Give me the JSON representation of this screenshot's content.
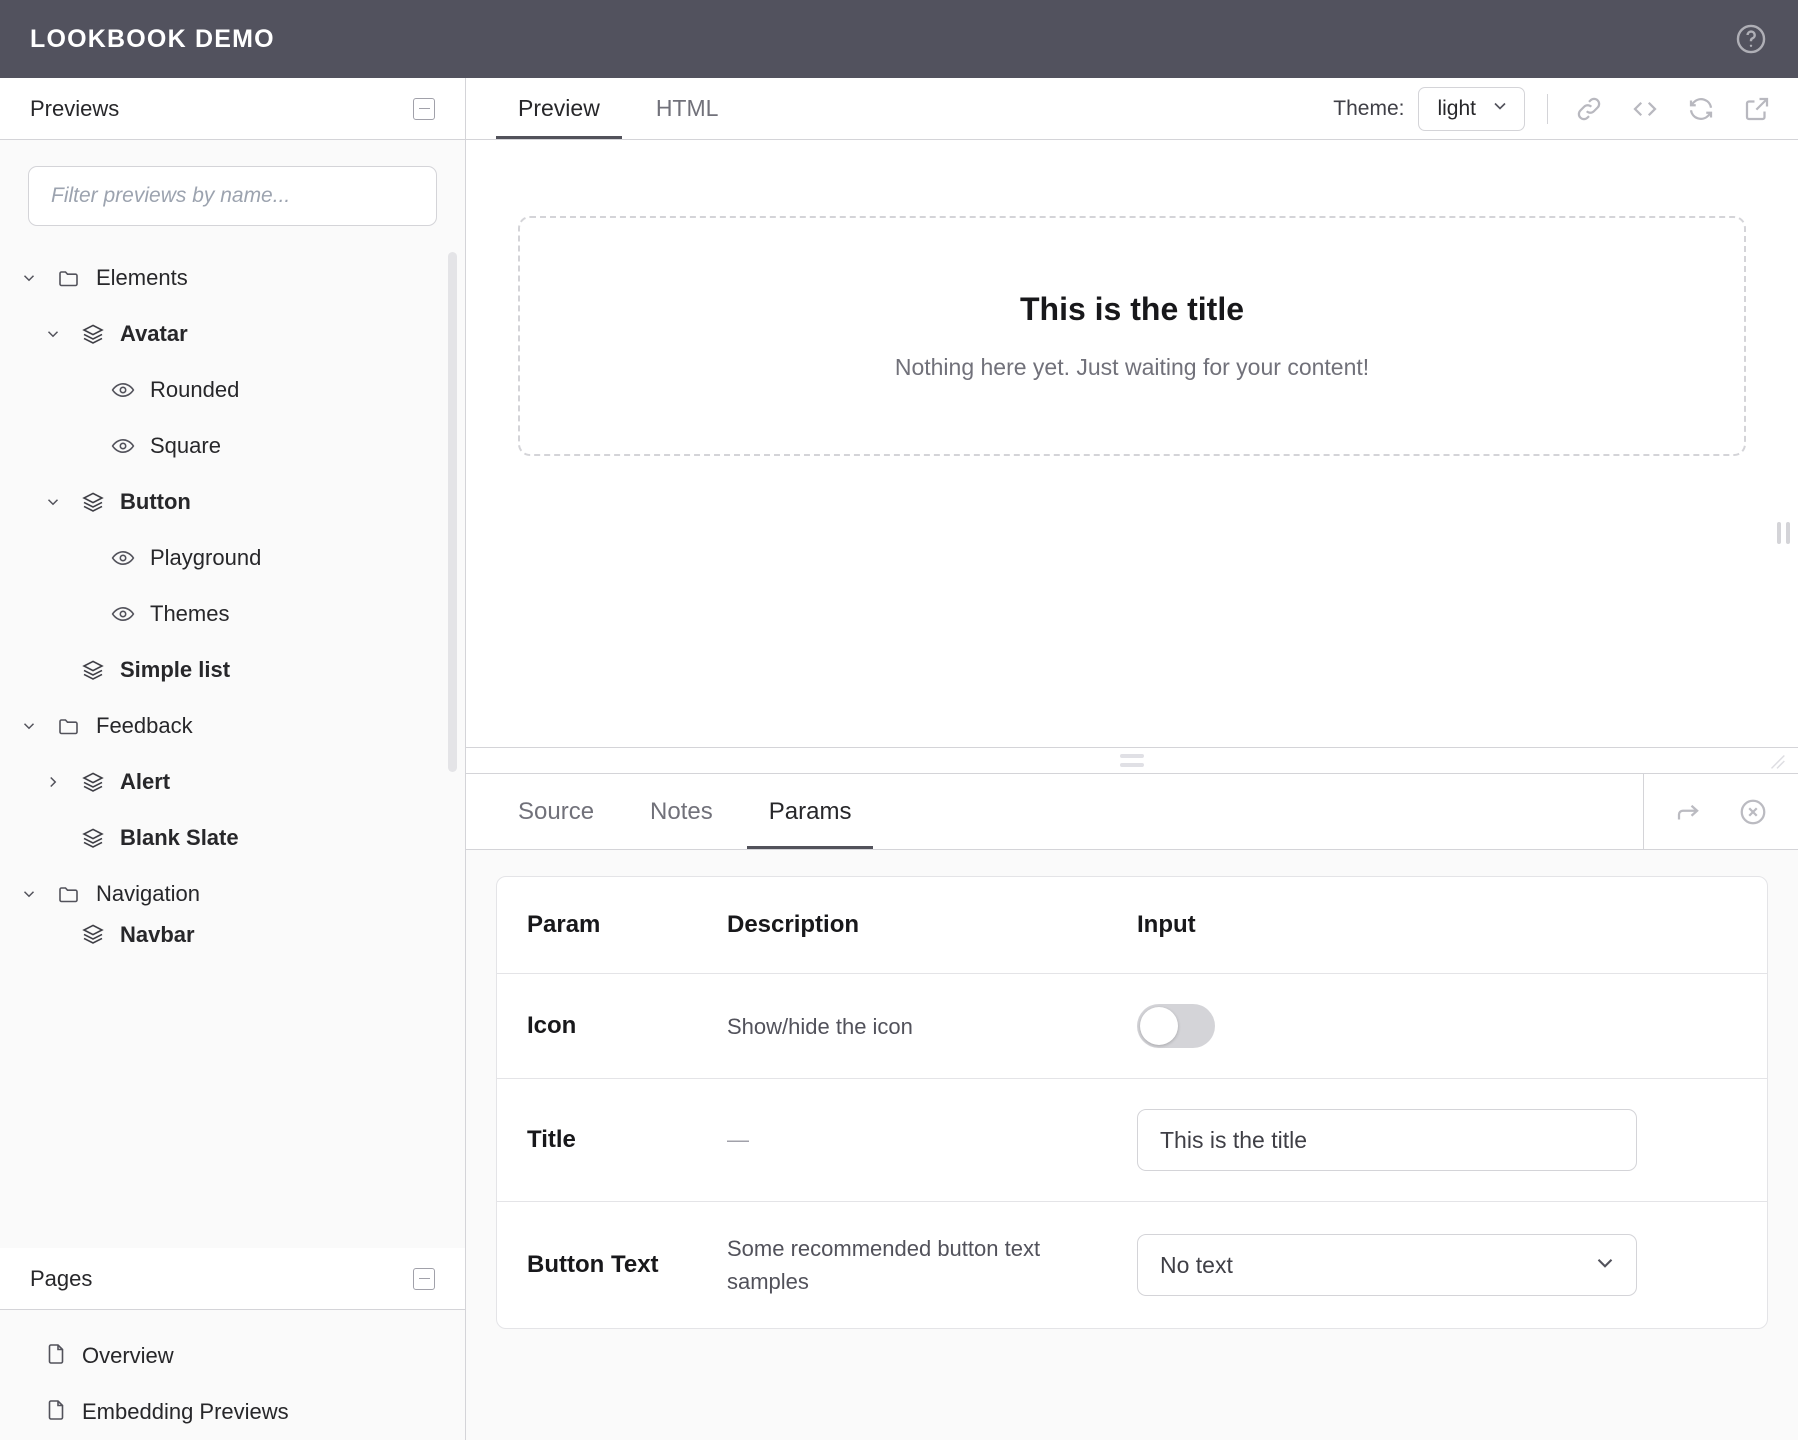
{
  "header": {
    "brand": "LOOKBOOK DEMO",
    "help_icon": "help-circle-icon"
  },
  "sidebar": {
    "previews_panel": {
      "title": "Previews",
      "collapse_icon": "minus-square-icon",
      "filter_placeholder": "Filter previews by name...",
      "tree": [
        {
          "label": "Elements",
          "type": "folder",
          "depth": 0,
          "expanded": true,
          "bold": false,
          "icon": "folder-icon"
        },
        {
          "label": "Avatar",
          "type": "scenario",
          "depth": 1,
          "expanded": true,
          "bold": true,
          "icon": "layers-icon"
        },
        {
          "label": "Rounded",
          "type": "preview",
          "depth": 2,
          "expanded": null,
          "bold": false,
          "icon": "eye-icon"
        },
        {
          "label": "Square",
          "type": "preview",
          "depth": 2,
          "expanded": null,
          "bold": false,
          "icon": "eye-icon"
        },
        {
          "label": "Button",
          "type": "scenario",
          "depth": 1,
          "expanded": true,
          "bold": true,
          "icon": "layers-icon"
        },
        {
          "label": "Playground",
          "type": "preview",
          "depth": 2,
          "expanded": null,
          "bold": false,
          "icon": "eye-icon"
        },
        {
          "label": "Themes",
          "type": "preview",
          "depth": 2,
          "expanded": null,
          "bold": false,
          "icon": "eye-icon"
        },
        {
          "label": "Simple list",
          "type": "scenario",
          "depth": 1,
          "expanded": null,
          "bold": true,
          "icon": "layers-icon"
        },
        {
          "label": "Feedback",
          "type": "folder",
          "depth": 0,
          "expanded": true,
          "bold": false,
          "icon": "folder-icon"
        },
        {
          "label": "Alert",
          "type": "scenario",
          "depth": 1,
          "expanded": false,
          "bold": true,
          "icon": "layers-icon"
        },
        {
          "label": "Blank Slate",
          "type": "scenario",
          "depth": 1,
          "expanded": null,
          "bold": true,
          "icon": "layers-icon"
        },
        {
          "label": "Navigation",
          "type": "folder",
          "depth": 0,
          "expanded": true,
          "bold": false,
          "icon": "folder-icon"
        },
        {
          "label": "Navbar",
          "type": "scenario",
          "depth": 1,
          "expanded": null,
          "bold": true,
          "icon": "layers-icon"
        }
      ]
    },
    "pages_panel": {
      "title": "Pages",
      "collapse_icon": "minus-square-icon",
      "items": [
        {
          "label": "Overview",
          "icon": "file-icon"
        },
        {
          "label": "Embedding Previews",
          "icon": "file-icon"
        }
      ]
    }
  },
  "preview": {
    "tabs": [
      {
        "label": "Preview",
        "active": true
      },
      {
        "label": "HTML",
        "active": false
      }
    ],
    "theme": {
      "label": "Theme:",
      "value": "light",
      "chevron_icon": "chevron-down-icon"
    },
    "toolbar_icons": [
      {
        "name": "link-icon"
      },
      {
        "name": "code-icon"
      },
      {
        "name": "refresh-icon"
      },
      {
        "name": "external-link-icon"
      }
    ],
    "stage": {
      "title": "This is the title",
      "subtitle": "Nothing here yet. Just waiting for your content!"
    }
  },
  "inspector": {
    "tabs": [
      {
        "label": "Source",
        "active": false
      },
      {
        "label": "Notes",
        "active": false
      },
      {
        "label": "Params",
        "active": true
      }
    ],
    "actions": [
      {
        "name": "share-arrow-icon"
      },
      {
        "name": "clear-circle-x-icon"
      }
    ],
    "params_table": {
      "columns": [
        "Param",
        "Description",
        "Input"
      ],
      "rows": [
        {
          "param": "Icon",
          "description": "Show/hide the icon",
          "input_type": "toggle",
          "value": "off"
        },
        {
          "param": "Title",
          "description": "—",
          "input_type": "text",
          "value": "This is the title"
        },
        {
          "param": "Button Text",
          "description": "Some recommended button text samples",
          "input_type": "select",
          "value": "No text"
        }
      ]
    }
  }
}
